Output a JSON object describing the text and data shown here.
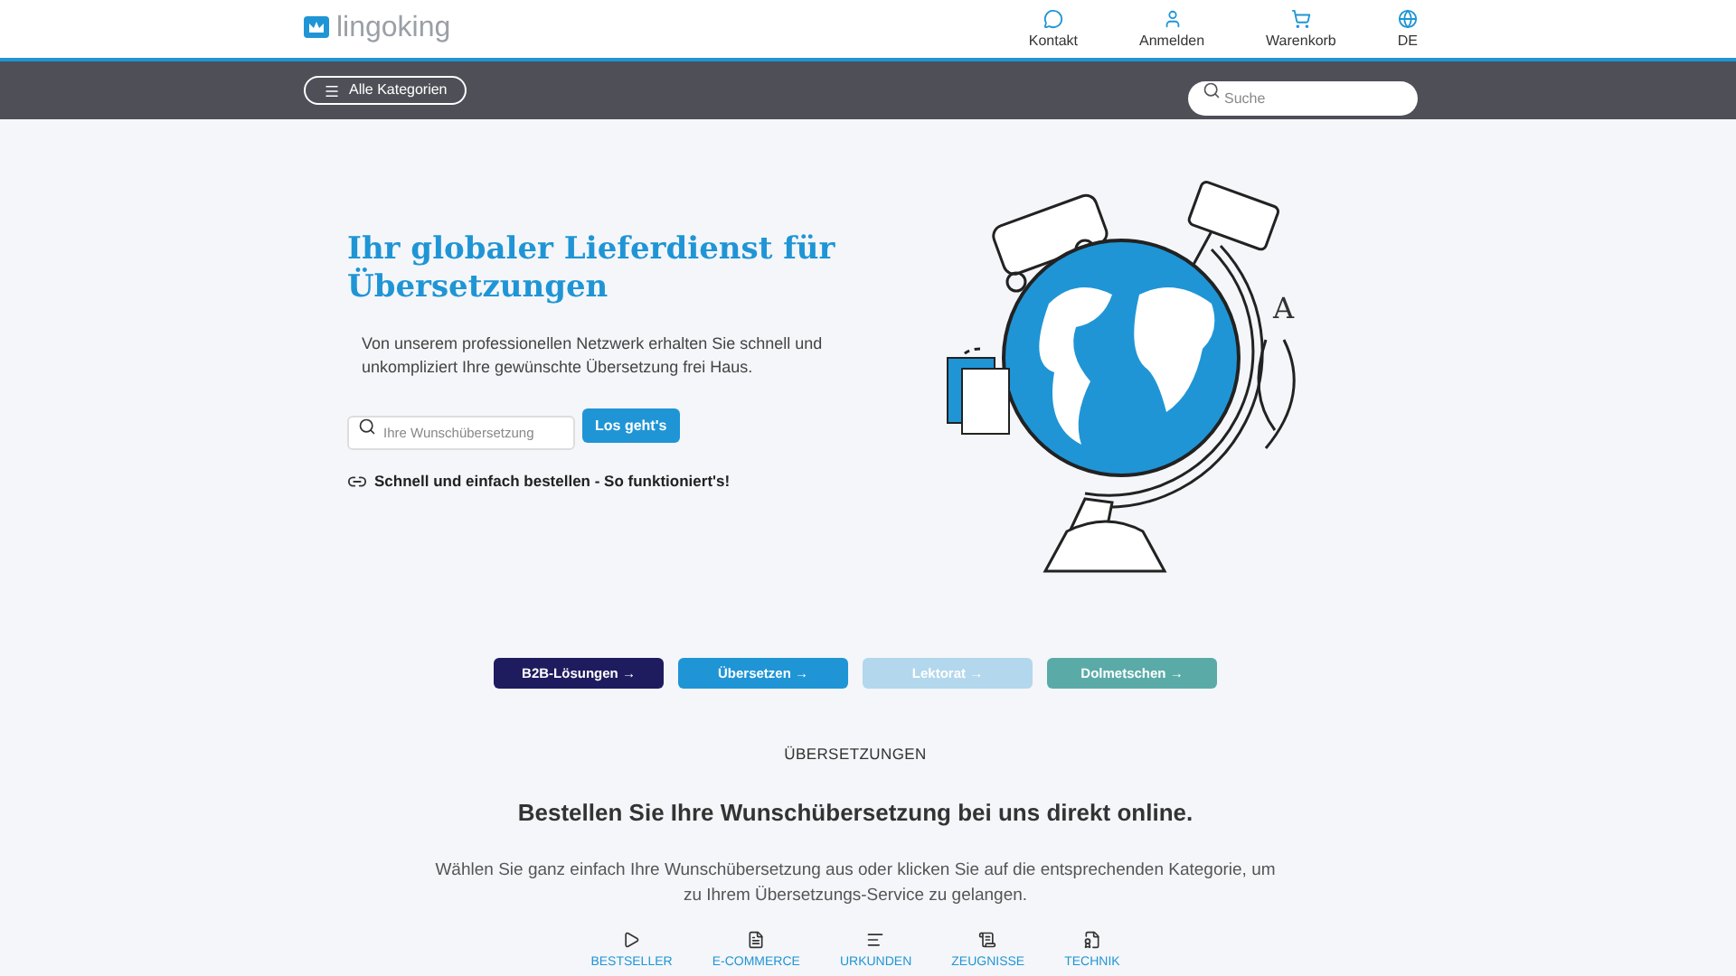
{
  "header": {
    "logo": "lingoking",
    "nav": [
      {
        "label": "Kontakt"
      },
      {
        "label": "Anmelden"
      },
      {
        "label": "Warenkorb"
      },
      {
        "label": "DE"
      }
    ]
  },
  "toolbar": {
    "categories_button": "Alle Kategorien",
    "search": {
      "placeholder": "Suche"
    }
  },
  "hero": {
    "title": "Ihr globaler Lieferdienst für Übersetzungen",
    "text": "Von unserem professionellen Netzwerk erhalten Sie schnell und unkompliziert Ihre gewünschte Übersetzung frei Haus.",
    "search": {
      "placeholder": "Ihre Wunschübersetzung"
    },
    "submit": "Los geht's",
    "howto_link": "Schnell und einfach bestellen - So funktioniert's!",
    "illustration_letter": "A"
  },
  "service_buttons": [
    {
      "label": "B2B-Lösungen →",
      "color": "#1e1b5e"
    },
    {
      "label": "Übersetzen →",
      "color": "#1f95d6"
    },
    {
      "label": "Lektorat →",
      "color": "#b3d7ec"
    },
    {
      "label": "Dolmetschen →",
      "color": "#5aaba8"
    }
  ],
  "section": {
    "eyebrow": "ÜBERSETZUNGEN",
    "heading": "Bestellen Sie Ihre Wunschübersetzung bei uns direkt online.",
    "text": "Wählen Sie ganz einfach Ihre Wunschübersetzung aus oder klicken Sie auf die entsprechenden Kategorie, um zu Ihrem Übersetzungs-Service zu gelangen.",
    "categories": [
      {
        "label": "BESTSELLER"
      },
      {
        "label": "E-COMMERCE"
      },
      {
        "label": "URKUNDEN"
      },
      {
        "label": "ZEUGNISSE"
      },
      {
        "label": "TECHNIK"
      }
    ]
  }
}
